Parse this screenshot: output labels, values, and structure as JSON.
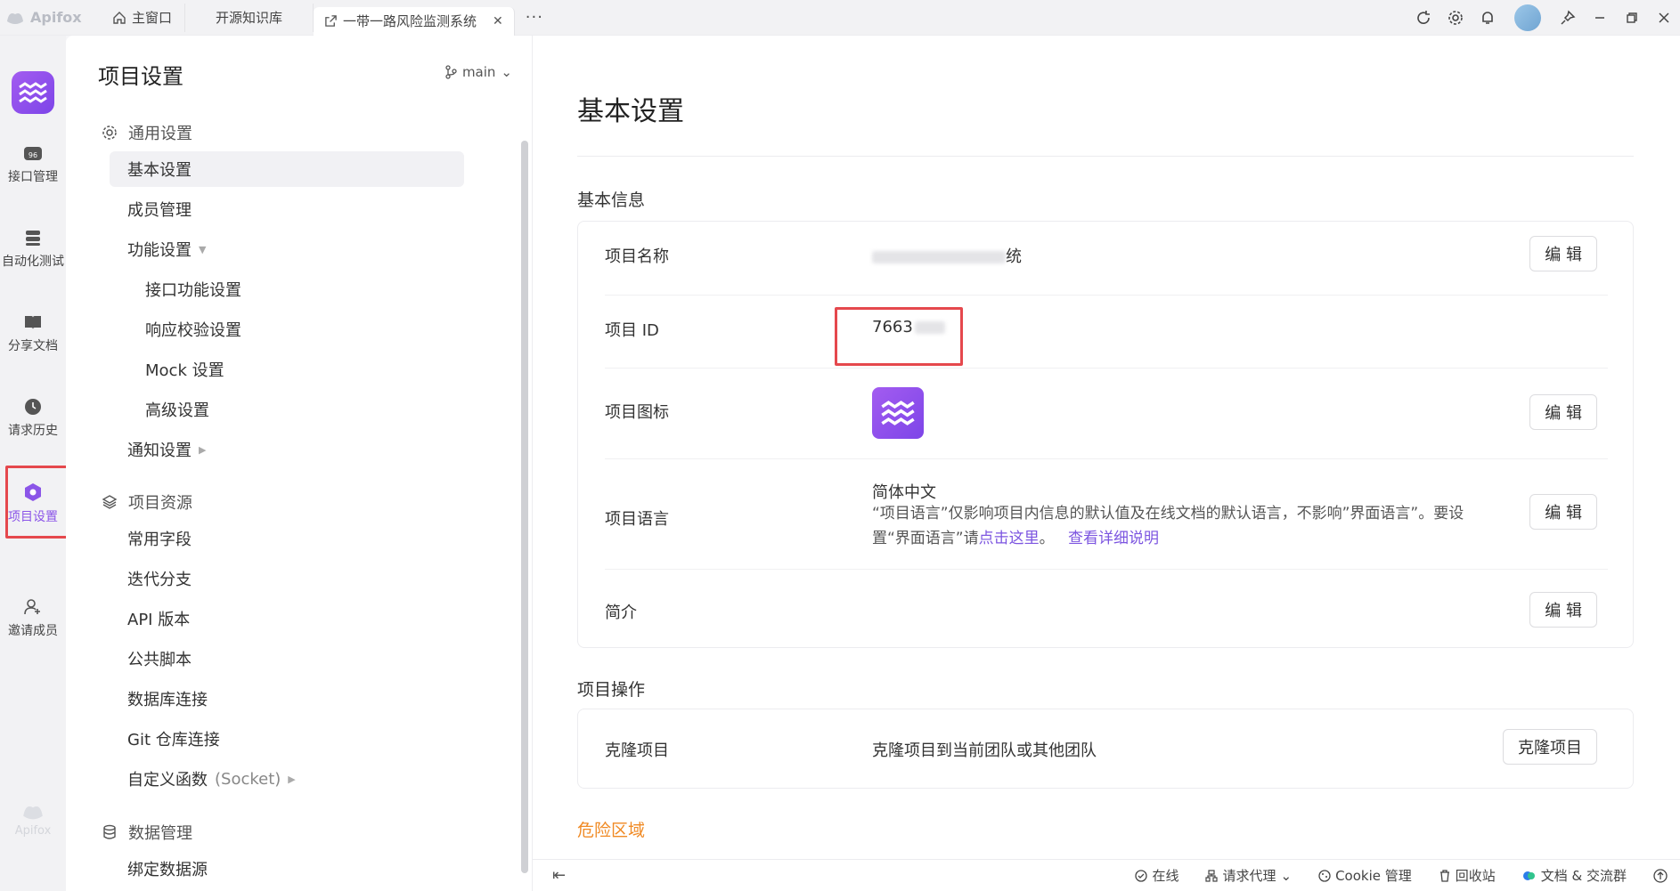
{
  "titlebar": {
    "brand": "Apifox",
    "tabs": [
      {
        "label": "主窗口"
      },
      {
        "label": "开源知识库"
      },
      {
        "label": "一带一路风险监测系统"
      }
    ],
    "more": "···"
  },
  "rail": {
    "items": [
      {
        "label": "接口管理"
      },
      {
        "label": "自动化测试"
      },
      {
        "label": "分享文档"
      },
      {
        "label": "请求历史"
      },
      {
        "label": "项目设置"
      },
      {
        "label": "邀请成员"
      }
    ],
    "footer": "Apifox"
  },
  "nav": {
    "title": "项目设置",
    "branch": "main",
    "groups": {
      "general": "通用设置",
      "resources": "项目资源",
      "data": "数据管理"
    },
    "items": {
      "basic": "基本设置",
      "members": "成员管理",
      "features": "功能设置",
      "api_features": "接口功能设置",
      "response_check": "响应校验设置",
      "mock": "Mock 设置",
      "advanced": "高级设置",
      "notify": "通知设置",
      "common_fields": "常用字段",
      "branches": "迭代分支",
      "api_versions": "API 版本",
      "public_scripts": "公共脚本",
      "db_conn": "数据库连接",
      "git_conn": "Git 仓库连接",
      "custom_func": "自定义函数",
      "custom_func_note": "(Socket)",
      "bind_ds": "绑定数据源"
    }
  },
  "main": {
    "title": "基本设置",
    "basic_info_title": "基本信息",
    "rows": {
      "name_label": "项目名称",
      "name_value_tail": "统",
      "id_label": "项目 ID",
      "id_value": "7663",
      "icon_label": "项目图标",
      "lang_label": "项目语言",
      "lang_value": "简体中文",
      "lang_desc_1": "“项目语言”仅影响项目内信息的默认值及在线文档的默认语言，不影响”界面语言”。要设置“界面语言”请",
      "lang_link": "点击这里",
      "lang_desc_2": "。",
      "lang_more": "查看详细说明",
      "intro_label": "简介"
    },
    "edit_label": "编 辑",
    "ops_title": "项目操作",
    "clone_label": "克隆项目",
    "clone_desc": "克隆项目到当前团队或其他团队",
    "clone_btn": "克隆项目",
    "danger_title": "危险区域"
  },
  "statusbar": {
    "online": "在线",
    "proxy": "请求代理",
    "cookie": "Cookie 管理",
    "recycle": "回收站",
    "docs": "文档 & 交流群"
  }
}
